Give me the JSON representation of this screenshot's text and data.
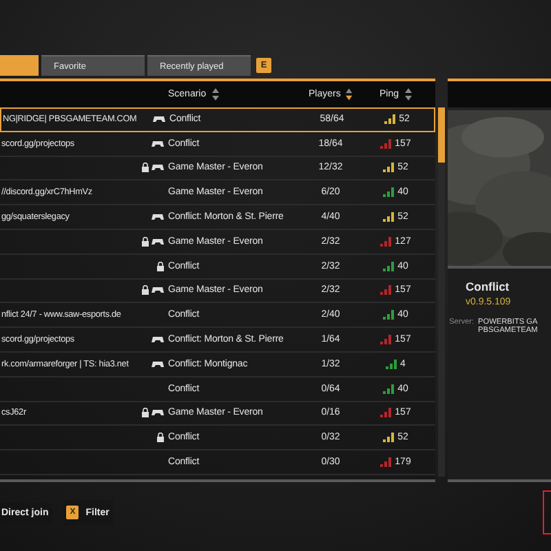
{
  "tabs": [
    {
      "selected": true
    },
    {
      "label": "Favorite",
      "selected": false
    },
    {
      "label": "Recently played",
      "selected": false
    }
  ],
  "tab_key": "E",
  "columns": [
    {
      "label": "Scenario",
      "sorted": false
    },
    {
      "label": "Players",
      "sorted": true
    },
    {
      "label": "Ping",
      "sorted": false
    }
  ],
  "rows": [
    {
      "name": "NG|RIDGE| PBSGAMETEAM.COM",
      "locked": false,
      "controller": true,
      "scenario": "Conflict",
      "players": "58/64",
      "ping": {
        "value": "52",
        "color": "#d9b43a"
      },
      "selected": true
    },
    {
      "name": "scord.gg/projectops",
      "locked": false,
      "controller": true,
      "scenario": "Conflict",
      "players": "18/64",
      "ping": {
        "value": "157",
        "color": "#b3262a"
      },
      "selected": false
    },
    {
      "locked": true,
      "controller": true,
      "scenario": "Game Master - Everon",
      "players": "12/32",
      "ping": {
        "value": "52",
        "color": "#d9b43a"
      },
      "selected": false
    },
    {
      "name": "//discord.gg/xrC7hHmVz",
      "locked": false,
      "controller": false,
      "scenario": "Game Master - Everon",
      "players": "6/20",
      "ping": {
        "value": "40",
        "color": "#2e9e3a"
      },
      "selected": false
    },
    {
      "name": "gg/squaterslegacy",
      "locked": false,
      "controller": true,
      "scenario": "Conflict: Morton & St. Pierre",
      "players": "4/40",
      "ping": {
        "value": "52",
        "color": "#d9b43a"
      },
      "selected": false
    },
    {
      "locked": true,
      "controller": true,
      "scenario": "Game Master - Everon",
      "players": "2/32",
      "ping": {
        "value": "127",
        "color": "#b3262a"
      },
      "selected": false
    },
    {
      "locked": true,
      "controller": false,
      "scenario": "Conflict",
      "players": "2/32",
      "ping": {
        "value": "40",
        "color": "#2e9e3a"
      },
      "selected": false
    },
    {
      "locked": true,
      "controller": true,
      "scenario": "Game Master - Everon",
      "players": "2/32",
      "ping": {
        "value": "157",
        "color": "#b3262a"
      },
      "selected": false
    },
    {
      "name": "nflict 24/7 - www.saw-esports.de",
      "locked": false,
      "controller": false,
      "scenario": "Conflict",
      "players": "2/40",
      "ping": {
        "value": "40",
        "color": "#2e9e3a"
      },
      "selected": false
    },
    {
      "name": "scord.gg/projectops",
      "locked": false,
      "controller": true,
      "scenario": "Conflict: Morton & St. Pierre",
      "players": "1/64",
      "ping": {
        "value": "157",
        "color": "#b3262a"
      },
      "selected": false
    },
    {
      "name": "rk.com/armareforger | TS: hia3.net",
      "locked": false,
      "controller": true,
      "scenario": "Conflict: Montignac",
      "players": "1/32",
      "ping": {
        "value": "4",
        "color": "#2e9e3a"
      },
      "selected": false
    },
    {
      "locked": false,
      "controller": false,
      "scenario": "Conflict",
      "players": "0/64",
      "ping": {
        "value": "40",
        "color": "#2e9e3a"
      },
      "selected": false
    },
    {
      "name": "csJ62r",
      "locked": true,
      "controller": true,
      "scenario": "Game Master - Everon",
      "players": "0/16",
      "ping": {
        "value": "157",
        "color": "#b3262a"
      },
      "selected": false
    },
    {
      "locked": true,
      "controller": false,
      "scenario": "Conflict",
      "players": "0/32",
      "ping": {
        "value": "52",
        "color": "#d9b43a"
      },
      "selected": false
    },
    {
      "locked": false,
      "controller": false,
      "scenario": "Conflict",
      "players": "0/30",
      "ping": {
        "value": "179",
        "color": "#b3262a"
      },
      "selected": false
    }
  ],
  "details": {
    "title": "Conflict",
    "version": "v0.9.5.109",
    "server_label": "Server:",
    "server": "POWERBITS GA PBSGAMETEAM"
  },
  "footer": {
    "direct_join": "Direct join",
    "filter_key": "X",
    "filter": "Filter"
  }
}
